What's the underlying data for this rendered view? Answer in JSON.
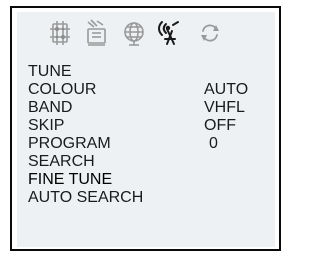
{
  "icons": [
    {
      "name": "picture-settings-icon"
    },
    {
      "name": "channel-settings-icon"
    },
    {
      "name": "globe-icon"
    },
    {
      "name": "antenna-icon"
    },
    {
      "name": "refresh-icon"
    }
  ],
  "menu": {
    "selected_icon": "antenna-icon",
    "items": [
      {
        "label": "TUNE",
        "value": ""
      },
      {
        "label": "COLOUR",
        "value": "AUTO"
      },
      {
        "label": "BAND",
        "value": "VHFL"
      },
      {
        "label": "SKIP",
        "value": "OFF"
      },
      {
        "label": "PROGRAM",
        "value": "0"
      },
      {
        "label": "SEARCH",
        "value": ""
      },
      {
        "label": "FINE TUNE",
        "value": ""
      },
      {
        "label": "AUTO SEARCH",
        "value": ""
      }
    ],
    "highlighted_item": "FINE TUNE"
  },
  "colors": {
    "panel_bg": "#edf1f4",
    "frame_border": "#0a0a0a",
    "text": "#1b1b1b"
  }
}
